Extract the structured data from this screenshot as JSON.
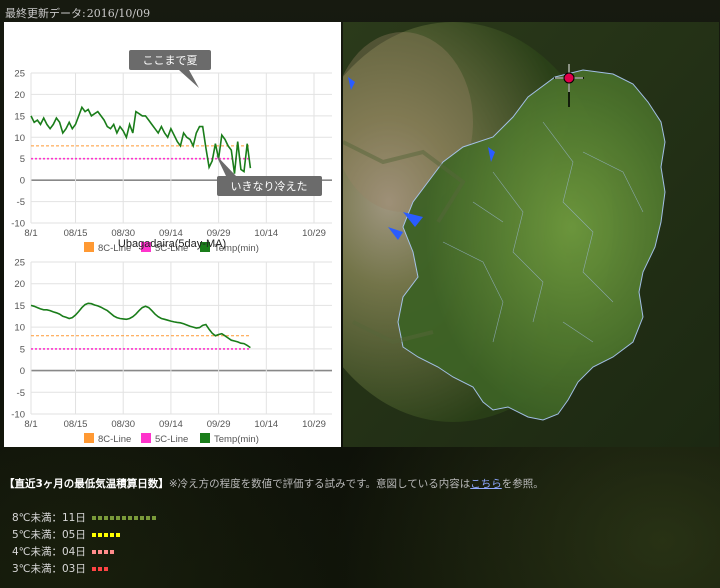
{
  "header": {
    "updated_label": "最終更新データ:",
    "updated_date": "2016/10/09"
  },
  "colors": {
    "line_8c": "#ff9933",
    "line_5c": "#ff33cc",
    "temp": "#1a7d1a",
    "bar_8": "#7a9a3a",
    "bar_5": "#ffff00",
    "bar_4": "#ff8c8c",
    "bar_3": "#ff4444"
  },
  "chart_data": [
    {
      "type": "line",
      "title": "Ubagadaira",
      "x": [
        "8/1",
        "8/2",
        "8/3",
        "8/4",
        "8/5",
        "8/6",
        "8/7",
        "8/8",
        "8/9",
        "8/10",
        "8/11",
        "8/12",
        "8/13",
        "8/14",
        "8/15",
        "8/16",
        "8/17",
        "8/18",
        "8/19",
        "8/20",
        "8/21",
        "8/22",
        "8/23",
        "8/24",
        "8/25",
        "8/26",
        "8/27",
        "8/28",
        "8/29",
        "8/30",
        "8/31",
        "9/1",
        "9/2",
        "9/3",
        "9/4",
        "9/5",
        "9/6",
        "9/7",
        "9/8",
        "9/9",
        "9/10",
        "9/11",
        "9/12",
        "9/13",
        "9/14",
        "9/15",
        "9/16",
        "9/17",
        "9/18",
        "9/19",
        "9/20",
        "9/21",
        "9/22",
        "9/23",
        "9/24",
        "9/25",
        "9/26",
        "9/27",
        "9/28",
        "9/29",
        "9/30",
        "10/1",
        "10/2",
        "10/3",
        "10/4",
        "10/5",
        "10/6",
        "10/7",
        "10/8",
        "10/9"
      ],
      "x_ticks": [
        "8/1",
        "08/15",
        "08/30",
        "09/14",
        "09/29",
        "10/14",
        "10/29"
      ],
      "ylim": [
        -10,
        25
      ],
      "y_ticks": [
        25,
        20,
        15,
        10,
        5,
        0,
        -5,
        -10
      ],
      "grid": true,
      "legend_position": "bottom",
      "series": [
        {
          "name": "8C-Line",
          "style": "dashed",
          "values": [
            8,
            8,
            8,
            8,
            8,
            8,
            8,
            8,
            8,
            8,
            8,
            8,
            8,
            8,
            8,
            8,
            8,
            8,
            8,
            8,
            8,
            8,
            8,
            8,
            8,
            8,
            8,
            8,
            8,
            8,
            8,
            8,
            8,
            8,
            8,
            8,
            8,
            8,
            8,
            8,
            8,
            8,
            8,
            8,
            8,
            8,
            8,
            8,
            8,
            8,
            8,
            8,
            8,
            8,
            8,
            8,
            8,
            8,
            8,
            8,
            8,
            8,
            8,
            8,
            8,
            8,
            8,
            8,
            8,
            8
          ]
        },
        {
          "name": "5C-Line",
          "style": "dotted",
          "values": [
            5,
            5,
            5,
            5,
            5,
            5,
            5,
            5,
            5,
            5,
            5,
            5,
            5,
            5,
            5,
            5,
            5,
            5,
            5,
            5,
            5,
            5,
            5,
            5,
            5,
            5,
            5,
            5,
            5,
            5,
            5,
            5,
            5,
            5,
            5,
            5,
            5,
            5,
            5,
            5,
            5,
            5,
            5,
            5,
            5,
            5,
            5,
            5,
            5,
            5,
            5,
            5,
            5,
            5,
            5,
            5,
            5,
            5,
            5,
            5,
            5,
            5,
            5,
            5,
            5,
            5,
            5,
            5,
            5,
            5
          ]
        },
        {
          "name": "Temp(min)",
          "values": [
            15,
            13.5,
            14,
            13,
            14.5,
            13,
            12,
            13,
            14.5,
            13.5,
            11,
            12,
            13.5,
            12,
            13,
            15,
            17,
            16,
            16.5,
            15,
            15.5,
            16,
            15,
            14,
            12.5,
            12,
            13,
            11,
            12.5,
            11.5,
            10,
            13,
            11,
            16,
            15.5,
            15,
            15,
            14,
            13,
            12,
            11,
            12.5,
            11,
            10,
            12,
            10.5,
            9,
            8,
            11,
            10,
            9.5,
            8,
            11,
            12.5,
            12.5,
            7.5,
            3,
            4.5,
            8.5,
            5,
            10.5,
            9.5,
            8,
            7,
            1.5,
            9,
            2.5,
            2,
            8.5,
            2.8
          ]
        }
      ],
      "annotations": [
        "ここまで夏",
        "いきなり冷えた"
      ]
    },
    {
      "type": "line",
      "title": "Ubagadaira(5day-MA)",
      "x_ticks": [
        "8/1",
        "08/15",
        "08/30",
        "09/14",
        "09/29",
        "10/14",
        "10/29"
      ],
      "ylim": [
        -10,
        25
      ],
      "y_ticks": [
        25,
        20,
        15,
        10,
        5,
        0,
        -5,
        -10
      ],
      "grid": true,
      "legend_position": "bottom",
      "series": [
        {
          "name": "8C-Line",
          "style": "dashed",
          "values": [
            8,
            8,
            8,
            8,
            8,
            8,
            8,
            8,
            8,
            8,
            8,
            8,
            8,
            8,
            8,
            8,
            8,
            8,
            8,
            8,
            8,
            8,
            8,
            8,
            8,
            8,
            8,
            8,
            8,
            8,
            8,
            8,
            8,
            8,
            8,
            8,
            8,
            8,
            8,
            8,
            8,
            8,
            8,
            8,
            8,
            8,
            8,
            8,
            8,
            8,
            8,
            8,
            8,
            8,
            8,
            8,
            8,
            8,
            8,
            8,
            8,
            8,
            8,
            8,
            8,
            8,
            8,
            8,
            8,
            8
          ]
        },
        {
          "name": "5C-Line",
          "style": "dotted",
          "values": [
            5,
            5,
            5,
            5,
            5,
            5,
            5,
            5,
            5,
            5,
            5,
            5,
            5,
            5,
            5,
            5,
            5,
            5,
            5,
            5,
            5,
            5,
            5,
            5,
            5,
            5,
            5,
            5,
            5,
            5,
            5,
            5,
            5,
            5,
            5,
            5,
            5,
            5,
            5,
            5,
            5,
            5,
            5,
            5,
            5,
            5,
            5,
            5,
            5,
            5,
            5,
            5,
            5,
            5,
            5,
            5,
            5,
            5,
            5,
            5,
            5,
            5,
            5,
            5,
            5,
            5,
            5,
            5,
            5,
            5
          ]
        },
        {
          "name": "Temp(min)",
          "values": [
            15,
            14.8,
            14.5,
            14.2,
            14,
            14,
            13.8,
            13.5,
            13.3,
            13,
            12.5,
            12.3,
            12,
            12.2,
            12.8,
            13.6,
            14.5,
            15.2,
            15.5,
            15.4,
            15.1,
            14.9,
            14.6,
            14.2,
            13.8,
            13.2,
            12.6,
            12.2,
            12,
            11.9,
            11.8,
            12,
            12.4,
            13,
            13.8,
            14.5,
            14.8,
            14.5,
            13.8,
            13,
            12.4,
            12,
            11.8,
            11.6,
            11.4,
            11.2,
            11.1,
            11,
            10.8,
            10.5,
            10.2,
            10,
            9.8,
            9.9,
            10.4,
            10.6,
            9.5,
            8.6,
            8,
            8.3,
            8.5,
            8,
            7.5,
            7,
            6.8,
            6.6,
            6.3,
            6.2,
            5.8,
            5.3
          ]
        }
      ]
    }
  ],
  "summary": {
    "heading": "【直近3ヶ月の最低気温積算日数】",
    "note_prefix": "※冷え方の程度を数値で評価する試みです。意図している内容は",
    "link": "こちら",
    "note_suffix": "を参照。",
    "rows": [
      {
        "label": "8℃未満：11日",
        "count": 11,
        "color": "#7a9a3a"
      },
      {
        "label": "5℃未満：05日",
        "count": 5,
        "color": "#ffff00"
      },
      {
        "label": "4℃未満：04日",
        "count": 4,
        "color": "#ff8c8c"
      },
      {
        "label": "3℃未満：03日",
        "count": 3,
        "color": "#ff4444"
      }
    ]
  }
}
